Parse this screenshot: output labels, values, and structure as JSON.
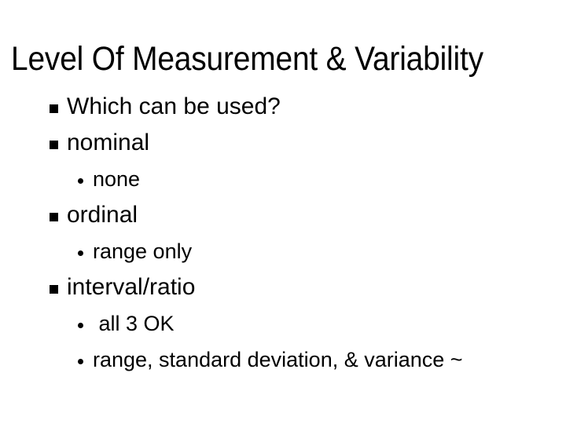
{
  "slide": {
    "title": "Level Of Measurement & Variability",
    "background_color": "#ffffff",
    "text_color": "#000000",
    "bullet_markers": {
      "level_1": "filled-square",
      "level_2": "filled-circle"
    },
    "bullets": [
      {
        "level": 1,
        "text": "Which can be used?"
      },
      {
        "level": 1,
        "text": "nominal"
      },
      {
        "level": 2,
        "text": "none"
      },
      {
        "level": 1,
        "text": "ordinal"
      },
      {
        "level": 2,
        "text": "range only"
      },
      {
        "level": 1,
        "text": "interval/ratio"
      },
      {
        "level": 2,
        "text": " all 3 OK"
      },
      {
        "level": 2,
        "text": "range, standard deviation, & variance ~"
      }
    ]
  }
}
